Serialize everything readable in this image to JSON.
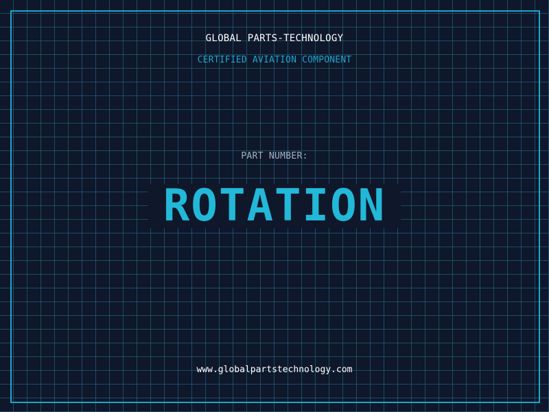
{
  "header": {
    "company": "GLOBAL PARTS-TECHNOLOGY",
    "subtitle": "CERTIFIED AVIATION COMPONENT"
  },
  "main": {
    "label": "PART NUMBER:",
    "part_number": "ROTATION"
  },
  "footer": {
    "url": "www.globalpartstechnology.com"
  },
  "colors": {
    "background": "#0f172a",
    "grid": "#1f5e78",
    "accent": "#1ba6cc",
    "part_number": "#22b8d8",
    "label": "#a3b0c2",
    "text": "#ffffff"
  }
}
